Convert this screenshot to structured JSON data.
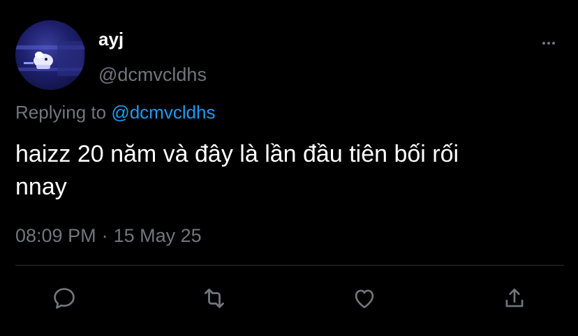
{
  "tweet": {
    "display_name": "ayj",
    "handle": "@dcmvcldhs",
    "reply_prefix": "Replying to",
    "reply_mention": "@dcmvcldhs",
    "text": "haizz 20 năm và đây là lần đầu tiên bối rối\nnnay",
    "time": "08:09 PM",
    "separator": "·",
    "date": "15 May 25"
  },
  "actions": {
    "reply_icon": "reply-icon",
    "retweet_icon": "retweet-icon",
    "like_icon": "heart-icon",
    "share_icon": "share-icon"
  },
  "colors": {
    "background": "#000000",
    "text_primary": "#ffffff",
    "text_secondary": "#71767b",
    "accent": "#1d9bf0",
    "divider": "#2f3336"
  }
}
